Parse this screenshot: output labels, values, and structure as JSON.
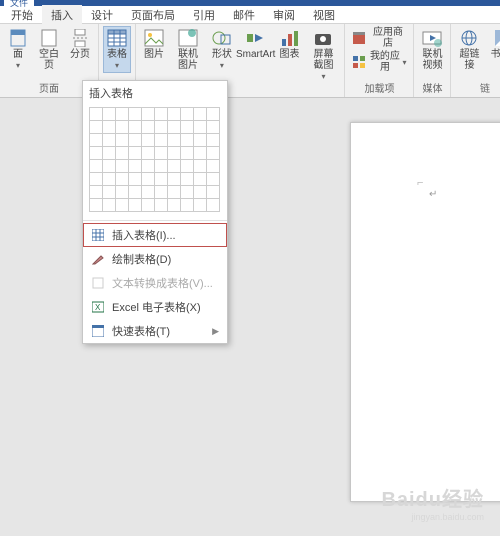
{
  "titlebar": {
    "file_label": "文件"
  },
  "tabs": {
    "items": [
      "开始",
      "插入",
      "设计",
      "页面布局",
      "引用",
      "邮件",
      "审阅",
      "视图"
    ],
    "active_index": 1
  },
  "ribbon": {
    "group_pages": {
      "label": "页面",
      "cover": "面",
      "blank": "空白页",
      "break": "分页"
    },
    "group_tables": {
      "label": "表格",
      "table": "表格"
    },
    "group_illus": {
      "pic": "图片",
      "online_pic": "联机图片",
      "shapes": "形状",
      "smartart": "SmartArt",
      "chart": "图表",
      "screenshot": "屏幕截图"
    },
    "group_addins": {
      "label": "加载项",
      "store": "应用商店",
      "myapps": "我的应用"
    },
    "group_media": {
      "label": "媒体",
      "video": "联机视频"
    },
    "group_links": {
      "label": "链",
      "hyperlink": "超链接",
      "bookmark": "书签"
    }
  },
  "dropdown": {
    "header": "插入表格",
    "insert_table": "插入表格(I)...",
    "draw_table": "绘制表格(D)",
    "convert_text": "文本转换成表格(V)...",
    "excel": "Excel 电子表格(X)",
    "quick_tables": "快速表格(T)"
  },
  "watermark": {
    "main": "Baidu经验",
    "sub": "jingyan.baidu.com"
  }
}
